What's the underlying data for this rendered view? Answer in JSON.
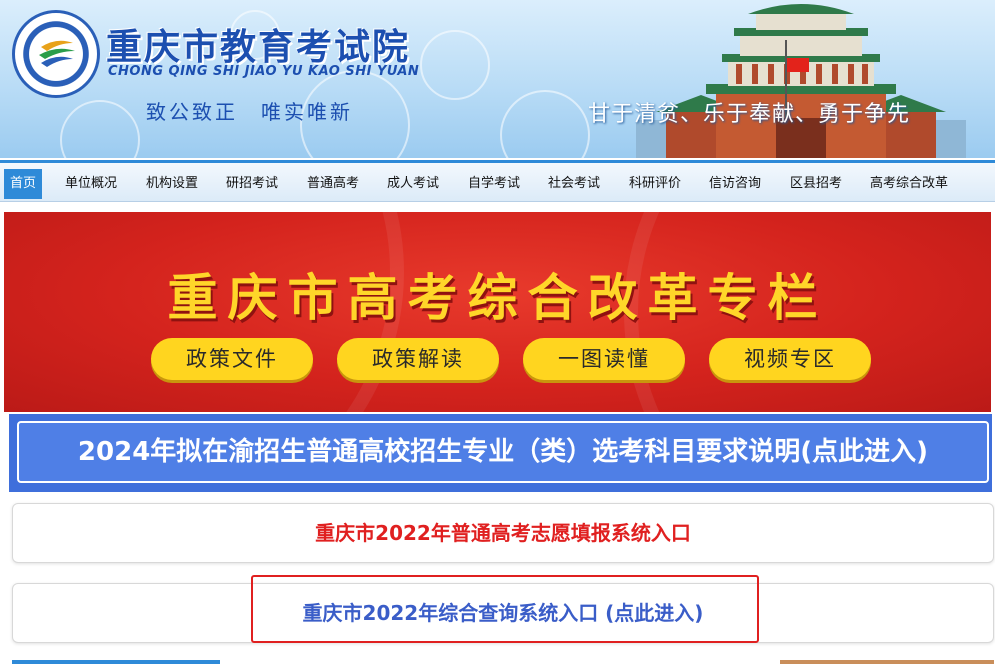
{
  "header": {
    "title_cn": "重庆市教育考试院",
    "title_en": "CHONG QING SHI JIAO YU KAO SHI YUAN",
    "motto_left": "致公致正　唯实唯新",
    "motto_right": "甘于清贫、乐于奉献、勇于争先",
    "logo_icon": "institute-logo-icon",
    "building_icon": "great-hall-building-icon"
  },
  "nav": {
    "items": [
      {
        "label": "首页",
        "active": true
      },
      {
        "label": "单位概况"
      },
      {
        "label": "机构设置"
      },
      {
        "label": "研招考试"
      },
      {
        "label": "普通高考"
      },
      {
        "label": "成人考试"
      },
      {
        "label": "自学考试"
      },
      {
        "label": "社会考试"
      },
      {
        "label": "科研评价"
      },
      {
        "label": "信访咨询"
      },
      {
        "label": "区县招考"
      },
      {
        "label": "高考综合改革"
      }
    ]
  },
  "banner": {
    "title": "重庆市高考综合改革专栏",
    "buttons": [
      "政策文件",
      "政策解读",
      "一图读懂",
      "视频专区"
    ]
  },
  "notice": {
    "text": "2024年拟在渝招生普通高校招生专业（类）选考科目要求说明(点此进入)"
  },
  "entries": {
    "volunteer": "重庆市2022年普通高考志愿填报系统入口",
    "query": "重庆市2022年综合查询系统入口 (点此进入)"
  },
  "colors": {
    "brand_blue": "#1c4fb0",
    "nav_active": "#2e8ad8",
    "banner_red": "#d4231d",
    "banner_gold": "#ffd629",
    "notice_blue": "#4f7fe6",
    "entry_red": "#e02020",
    "entry_blue": "#3a5dc8"
  }
}
